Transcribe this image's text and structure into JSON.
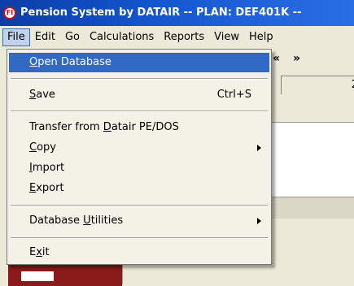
{
  "window": {
    "icon_text": "FI",
    "title": "Pension System by DATAIR -- PLAN: DEF401K --"
  },
  "menubar": [
    "File",
    "Edit",
    "Go",
    "Calculations",
    "Reports",
    "View",
    "Help"
  ],
  "toolbar": {
    "nav_prev": "«",
    "nav_next": "»",
    "tab_number": "2"
  },
  "file_menu": {
    "open_database": {
      "pre": "",
      "acc": "O",
      "post": "pen Database"
    },
    "save": {
      "pre": "",
      "acc": "S",
      "post": "ave",
      "shortcut": "Ctrl+S"
    },
    "transfer": {
      "pre": "Transfer from ",
      "acc": "D",
      "post": "atair PE/DOS"
    },
    "copy": {
      "pre": "",
      "acc": "C",
      "post": "opy"
    },
    "import": {
      "pre": "",
      "acc": "I",
      "post": "mport"
    },
    "export": {
      "pre": "",
      "acc": "E",
      "post": "xport"
    },
    "database_utilities": {
      "pre": "Database ",
      "acc": "U",
      "post": "tilities"
    },
    "exit": {
      "pre": "E",
      "acc": "x",
      "post": "it"
    }
  }
}
